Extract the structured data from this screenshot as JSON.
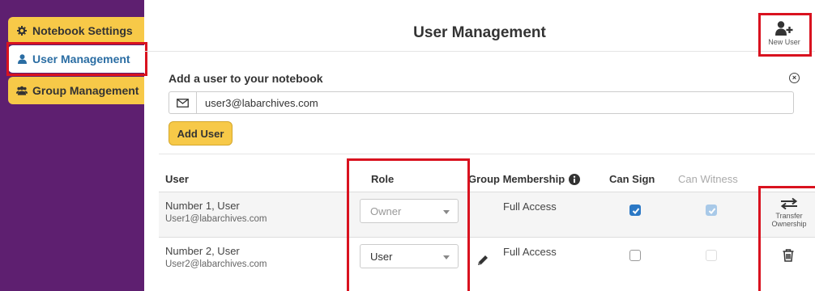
{
  "sidebar": {
    "items": [
      {
        "label": "Notebook Settings",
        "icon": "gear-icon",
        "active": false
      },
      {
        "label": "User Management",
        "icon": "user-icon",
        "active": true
      },
      {
        "label": "Group Management",
        "icon": "users-icon",
        "active": false
      }
    ]
  },
  "header": {
    "title": "User Management",
    "new_user_label": "New User"
  },
  "add_user": {
    "heading": "Add a user to your notebook",
    "email_value": "user3@labarchives.com",
    "button_label": "Add User"
  },
  "table": {
    "columns": [
      "User",
      "Role",
      "Group Membership",
      "Can Sign",
      "Can Witness"
    ],
    "rows": [
      {
        "name": "Number 1, User",
        "email": "User1@labarchives.com",
        "role": "Owner",
        "group_membership": "Full Access",
        "can_sign": true,
        "can_witness": true,
        "action_label": "Transfer Ownership"
      },
      {
        "name": "Number 2, User",
        "email": "User2@labarchives.com",
        "role": "User",
        "group_membership": "Full Access",
        "can_sign": false,
        "can_witness": false
      }
    ],
    "transfer_line1": "Transfer",
    "transfer_line2": "Ownership"
  },
  "colors": {
    "sidebar_bg": "#5e1f70",
    "tab_yellow": "#f7c948",
    "active_text": "#2a6da3",
    "checkbox_blue": "#2b78c5",
    "highlight_red": "#d9121f"
  }
}
